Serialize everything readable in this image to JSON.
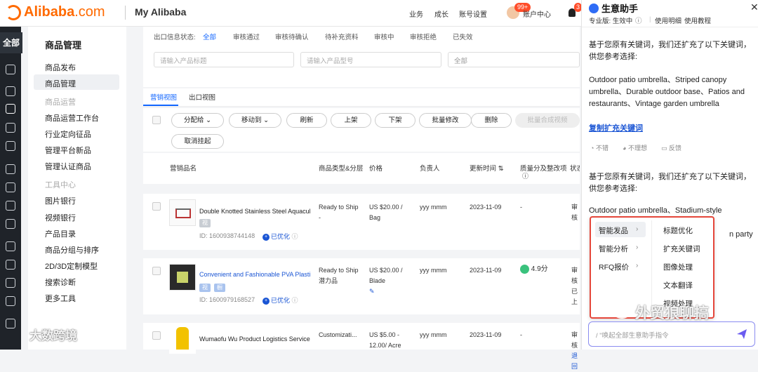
{
  "header": {
    "brand": "Alibaba",
    "brand_suffix": ".com",
    "title": "My Alibaba",
    "nav": [
      "业务",
      "成长",
      "账号设置"
    ],
    "badge": "99+",
    "account": "账户中心",
    "badge2": "3"
  },
  "iconbar": {
    "all": "全部"
  },
  "sidebar": {
    "title": "商品管理",
    "items": [
      {
        "label": "商品发布",
        "type": "item"
      },
      {
        "label": "商品管理",
        "type": "selected"
      },
      {
        "label": "商品运营",
        "type": "group"
      },
      {
        "label": "商品运营工作台",
        "type": "item"
      },
      {
        "label": "行业定向征品",
        "type": "item"
      },
      {
        "label": "管理平台新品",
        "type": "item"
      },
      {
        "label": "管理认证商品",
        "type": "item"
      },
      {
        "label": "工具中心",
        "type": "group"
      },
      {
        "label": "图片银行",
        "type": "item"
      },
      {
        "label": "视频银行",
        "type": "item"
      },
      {
        "label": "产品目录",
        "type": "item"
      },
      {
        "label": "商品分组与排序",
        "type": "item"
      },
      {
        "label": "2D/3D定制模型",
        "type": "item"
      },
      {
        "label": "搜索诊断",
        "type": "item"
      },
      {
        "label": "更多工具",
        "type": "item"
      }
    ]
  },
  "filter": {
    "label": "出口信息状态:",
    "statuses": [
      "全部",
      "审核通过",
      "审核待确认",
      "待补充资料",
      "审核中",
      "审核拒绝",
      "已失效"
    ],
    "title_placeholder": "请输入产品标题",
    "model_placeholder": "请输入产品型号",
    "select_value": "全部"
  },
  "view_tabs": [
    "营销视图",
    "出口视图"
  ],
  "actions": [
    "分配给",
    "移动到",
    "刷新",
    "上架",
    "下架",
    "批量修改",
    "删除",
    "批量合成视频",
    "取消挂起"
  ],
  "table": {
    "headers": [
      "营销品名",
      "商品类型&分层",
      "价格",
      "负责人",
      "更新时间",
      "质量分及整改项",
      "状态"
    ],
    "rows": [
      {
        "name": "Double Knotted Stainless Steel Aquaculture",
        "tags": [
          "视"
        ],
        "id": "ID: 1600938744148",
        "opt": "已优化",
        "type": [
          "Ready to Ship",
          "-"
        ],
        "price": [
          "US $20.00 /",
          "Bag"
        ],
        "owner": "yyy mmm",
        "date": "2023-11-09",
        "score": "-",
        "status": [
          "审核"
        ]
      },
      {
        "name": "Convenient and Fashionable PVA Plastic",
        "tags": [
          "视",
          "橱"
        ],
        "id": "ID: 1600979168527",
        "opt": "已优化",
        "type": [
          "Ready to Ship",
          "潜力品"
        ],
        "price": [
          "US $20.00 /",
          "Blade"
        ],
        "owner": "yyy mmm",
        "date": "2023-11-09",
        "score": "4.9分",
        "status": [
          "审核",
          "已上"
        ]
      },
      {
        "name": "Wumaofu Wu Product Logistics Service",
        "tags": [],
        "id": "",
        "opt": "",
        "type": [
          "Customizati..."
        ],
        "price": [
          "US $5.00 -",
          "12.00/ Acre"
        ],
        "owner": "yyy mmm",
        "date": "2023-11-09",
        "score": "-",
        "status": [
          "审核",
          "退回"
        ]
      }
    ]
  },
  "assistant": {
    "title": "生意助手",
    "edition": "专业版: 生效中",
    "links": [
      "使用明细",
      "使用教程"
    ],
    "msg1": "基于您原有关键词，我们还扩充了以下关键词，供您参考选择:",
    "keywords1": "Outdoor patio umbrella、Striped canopy umbrella、Durable outdoor base、Patios and restaurants、Vintage garden umbrella",
    "copy_link": "复制扩充关键词",
    "feedback": [
      "不错",
      "不理想",
      "反馈"
    ],
    "msg2": "基于您原有关键词，我们还扩充了以下关键词，供您参考选择:",
    "keywords2": "Outdoor patio umbrella、Stadium-style",
    "keywords2_tail": "n party",
    "menu_left": [
      "智能发品",
      "智能分析",
      "RFQ报价"
    ],
    "menu_right": [
      "标题优化",
      "扩充关键词",
      "图像处理",
      "文本翻译",
      "视频处理"
    ],
    "input_placeholder": "/ \"唤起全部生意助手指令"
  },
  "watermarks": {
    "left": "大数跨境",
    "right": "外贸狼聊搞"
  }
}
